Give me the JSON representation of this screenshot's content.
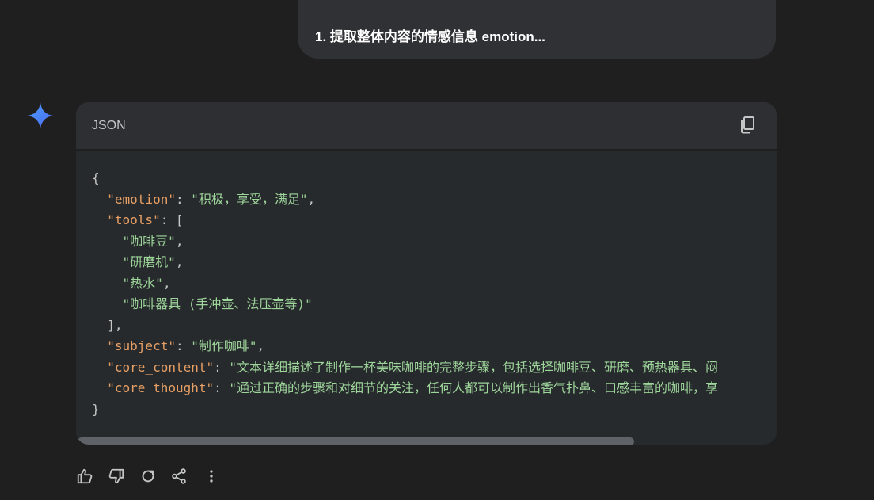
{
  "user_message": {
    "text": "1. 提取整体内容的情感信息 emotion..."
  },
  "assistant": {
    "icon": "gemini-sparkle-icon"
  },
  "code_block": {
    "language": "JSON",
    "copy_icon": "copy-icon",
    "lines": {
      "l1": "{",
      "emotion_key": "\"emotion\"",
      "emotion_val": "\"积极，享受，满足\"",
      "tools_key": "\"tools\"",
      "tools_open": "[",
      "tool1": "\"咖啡豆\"",
      "tool2": "\"研磨机\"",
      "tool3": "\"热水\"",
      "tool4": "\"咖啡器具 (手冲壶、法压壶等)\"",
      "tools_close": "],",
      "subject_key": "\"subject\"",
      "subject_val": "\"制作咖啡\"",
      "core_content_key": "\"core_content\"",
      "core_content_val": "\"文本详细描述了制作一杯美味咖啡的完整步骤，包括选择咖啡豆、研磨、预热器具、闷",
      "core_thought_key": "\"core_thought\"",
      "core_thought_val": "\"通过正确的步骤和对细节的关注，任何人都可以制作出香气扑鼻、口感丰富的咖啡，享",
      "l_end": "}"
    }
  },
  "actions": [
    {
      "name": "thumbs-up-icon"
    },
    {
      "name": "thumbs-down-icon"
    },
    {
      "name": "regenerate-icon"
    },
    {
      "name": "share-icon"
    },
    {
      "name": "more-options-icon"
    }
  ]
}
